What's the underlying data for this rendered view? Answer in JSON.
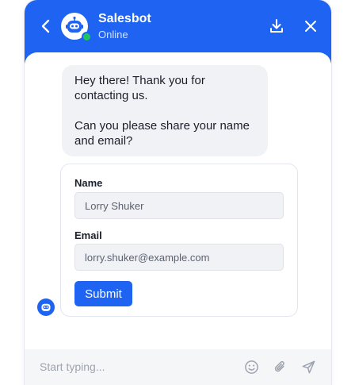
{
  "header": {
    "bot_name": "Salesbot",
    "status": "Online",
    "back_icon": "chevron-left-icon",
    "download_icon": "download-icon",
    "close_icon": "close-icon"
  },
  "messages": [
    {
      "paragraphs": [
        "Hey there! Thank you for contacting us.",
        "Can you please share your name and email?"
      ]
    }
  ],
  "form": {
    "name_label": "Name",
    "name_value": "Lorry Shuker",
    "email_label": "Email",
    "email_value": "lorry.shuker@example.com",
    "submit_label": "Submit"
  },
  "composer": {
    "placeholder": "Start typing...",
    "emoji_icon": "emoji-icon",
    "attach_icon": "paperclip-icon",
    "send_icon": "send-icon"
  },
  "colors": {
    "brand": "#1f63f2",
    "online": "#21c55d",
    "bubble": "#f1f2f5"
  }
}
